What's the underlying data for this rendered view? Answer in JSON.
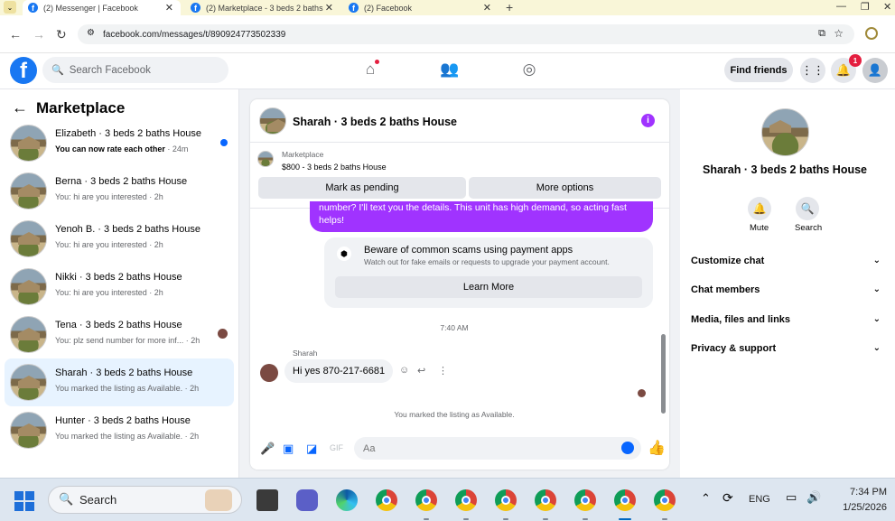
{
  "browser": {
    "tabs": [
      {
        "title": "(2) Messenger | Facebook",
        "active": true
      },
      {
        "title": "(2) Marketplace - 3 beds 2 baths",
        "active": false
      },
      {
        "title": "(2) Facebook",
        "active": false
      }
    ],
    "url": "facebook.com/messages/t/890924773502339"
  },
  "fb": {
    "search_placeholder": "Search Facebook",
    "find_friends": "Find friends",
    "notification_count": "1",
    "accent": "#0866ff"
  },
  "sidebar": {
    "title": "Marketplace",
    "conversations": [
      {
        "name": "Elizabeth · 3 beds 2 baths House",
        "snippet": "You can now rate each other",
        "time": "· 24m",
        "unread": true
      },
      {
        "name": "Berna · 3 beds 2 baths House",
        "snippet": "You: hi are you interested",
        "time": "· 2h"
      },
      {
        "name": "Yenoh B. · 3 beds 2 baths House",
        "snippet": "You: hi are you interested",
        "time": "· 2h"
      },
      {
        "name": "Nikki · 3 beds 2 baths House",
        "snippet": "You: hi are you interested",
        "time": "· 2h"
      },
      {
        "name": "Tena · 3 beds 2 baths House",
        "snippet": "You: plz send number for more inf...",
        "time": "· 2h"
      },
      {
        "name": "Sharah · 3 beds 2 baths House",
        "snippet": "You marked the listing as Available.",
        "time": "· 2h",
        "selected": true
      },
      {
        "name": "Hunter · 3 beds 2 baths House",
        "snippet": "You marked the listing as Available.",
        "time": "· 2h"
      }
    ]
  },
  "chat": {
    "title": "Sharah · 3 beds 2 baths House",
    "marketplace_label": "Marketplace",
    "listing": "$800 - 3 beds 2 baths House",
    "mark_pending": "Mark as pending",
    "more_options": "More options",
    "outgoing_text": "number? I'll text you the details. This unit has high demand, so acting fast helps!",
    "scam_title": "Beware of common scams using payment apps",
    "scam_sub": "Watch out for fake emails or requests to upgrade your payment account.",
    "learn_more": "Learn More",
    "timestamp": "7:40 AM",
    "sender": "Sharah",
    "incoming": "Hi yes 870-217-6681",
    "system_msg": "You marked the listing as Available.",
    "composer_placeholder": "Aa",
    "bubble_color": "#a033ff"
  },
  "details": {
    "title": "Sharah · 3 beds 2 baths House",
    "mute": "Mute",
    "search": "Search",
    "sections": [
      "Customize chat",
      "Chat members",
      "Media, files and links",
      "Privacy & support"
    ]
  },
  "taskbar": {
    "search": "Search",
    "lang": "ENG",
    "time": "7:34 PM",
    "date": "1/25/2026"
  }
}
